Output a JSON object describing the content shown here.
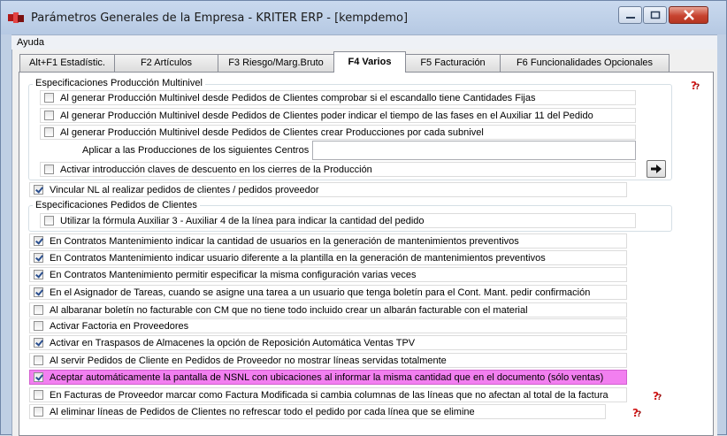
{
  "window": {
    "title": "Parámetros Generales de la Empresa - KRITER ERP - [kempdemo]"
  },
  "menu": {
    "items": [
      "Ayuda"
    ]
  },
  "tabs": [
    {
      "label": "Alt+F1 Estadístic.",
      "active": false
    },
    {
      "label": "F2 Artículos",
      "active": false
    },
    {
      "label": "F3 Riesgo/Marg.Bruto",
      "active": false
    },
    {
      "label": "F4 Varios",
      "active": true
    },
    {
      "label": "F5 Facturación",
      "active": false
    },
    {
      "label": "F6 Funcionalidades Opcionales",
      "active": false
    }
  ],
  "produccion": {
    "group_label": "Especificaciones Producción Multinivel",
    "items": [
      {
        "label": "Al generar Producción Multinivel desde Pedidos de Clientes comprobar si el escandallo tiene Cantidades Fijas",
        "checked": false
      },
      {
        "label": "Al generar Producción Multinivel desde Pedidos de Clientes poder indicar el tiempo de las fases en el Auxiliar 11 del Pedido",
        "checked": false
      },
      {
        "label": "Al generar Producción Multinivel desde Pedidos de Clientes crear Producciones por cada subnivel",
        "checked": false
      }
    ],
    "centros_label": "Aplicar a las Producciones de los siguientes Centros",
    "centros_value": "",
    "descuento": {
      "label": "Activar introducción claves de descuento en los cierres de la Producción",
      "checked": false
    }
  },
  "vincular": {
    "label": "Vincular NL al realizar  pedidos de clientes /  pedidos proveedor",
    "checked": true
  },
  "pedidos": {
    "group_label": "Especificaciones Pedidos de Clientes",
    "item": {
      "label": "Utilizar la fórmula Auxiliar 3 - Auxiliar 4 de la línea para indicar la cantidad del pedido",
      "checked": false
    }
  },
  "options": [
    {
      "label": "En Contratos Mantenimiento indicar la cantidad de usuarios en la generación de mantenimientos preventivos",
      "checked": true,
      "highlight": false
    },
    {
      "label": "En Contratos Mantenimiento indicar usuario diferente a la plantilla en la generación de mantenimientos preventivos",
      "checked": true,
      "highlight": false
    },
    {
      "label": "En Contratos Mantenimiento permitir especificar la misma configuración varias veces",
      "checked": true,
      "highlight": false
    },
    {
      "label": "En el Asignador de Tareas, cuando se asigne una tarea a un usuario que tenga boletín para el Cont. Mant. pedir confirmación",
      "checked": true,
      "highlight": false
    },
    {
      "label": "Al albaranar boletín no facturable con CM que no tiene todo incluido crear un albarán facturable con el material",
      "checked": false,
      "highlight": false
    },
    {
      "label": "Activar Factoria en Proveedores",
      "checked": false,
      "highlight": false
    },
    {
      "label": "Activar en Traspasos de Almacenes la opción de Reposición Automática Ventas TPV",
      "checked": true,
      "highlight": false
    },
    {
      "label": "Al servir Pedidos de Cliente en Pedidos de Proveedor no mostrar líneas servidas totalmente",
      "checked": false,
      "highlight": false
    },
    {
      "label": "Aceptar automáticamente la pantalla de NSNL con ubicaciones al informar la misma cantidad que en el documento (sólo ventas)",
      "checked": true,
      "highlight": true
    },
    {
      "label": "En Facturas de Proveedor marcar como Factura Modificada si cambia columnas de las líneas que no afectan al total de la factura",
      "checked": false,
      "highlight": false
    },
    {
      "label": "Al eliminar líneas de Pedidos de Clientes no refrescar todo el pedido por cada línea que se elimine",
      "checked": false,
      "highlight": false
    }
  ],
  "colors": {
    "highlight": "#f27ff0",
    "help_icon": "#d11a1a"
  },
  "icons": [
    "app-icon",
    "minimize-icon",
    "maximize-icon",
    "close-icon",
    "arrow-right-icon",
    "help-icon"
  ]
}
